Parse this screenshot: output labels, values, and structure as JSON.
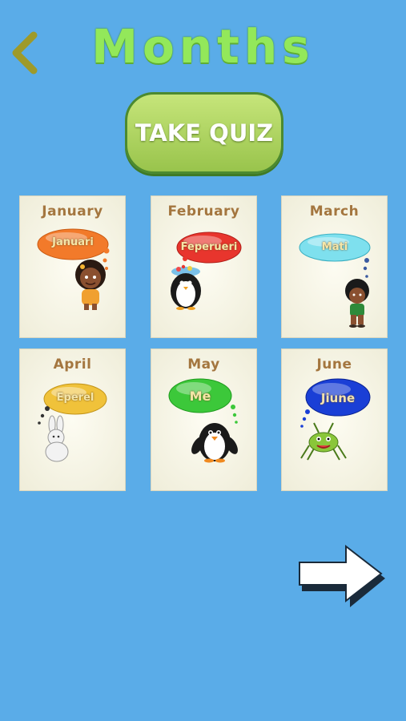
{
  "header": {
    "title": "Months",
    "back_icon": "chevron-left-icon"
  },
  "quiz": {
    "label": "TAKE QUIZ"
  },
  "cards": [
    {
      "month": "January",
      "word": "Januari",
      "cloud": "#f27a2a",
      "character": "girl"
    },
    {
      "month": "February",
      "word": "Feperueri",
      "cloud": "#e8352d",
      "character": "penguin-with-hat"
    },
    {
      "month": "March",
      "word": "Mati",
      "cloud": "#7ee0ee",
      "character": "boy"
    },
    {
      "month": "April",
      "word": "Eperel",
      "cloud": "#f0c23a",
      "character": "bunny"
    },
    {
      "month": "May",
      "word": "Me",
      "cloud": "#3cc83a",
      "character": "penguin"
    },
    {
      "month": "June",
      "word": "Jiune",
      "cloud": "#1a3fd6",
      "character": "grasshopper"
    }
  ],
  "footer": {
    "next_icon": "arrow-right-icon"
  }
}
